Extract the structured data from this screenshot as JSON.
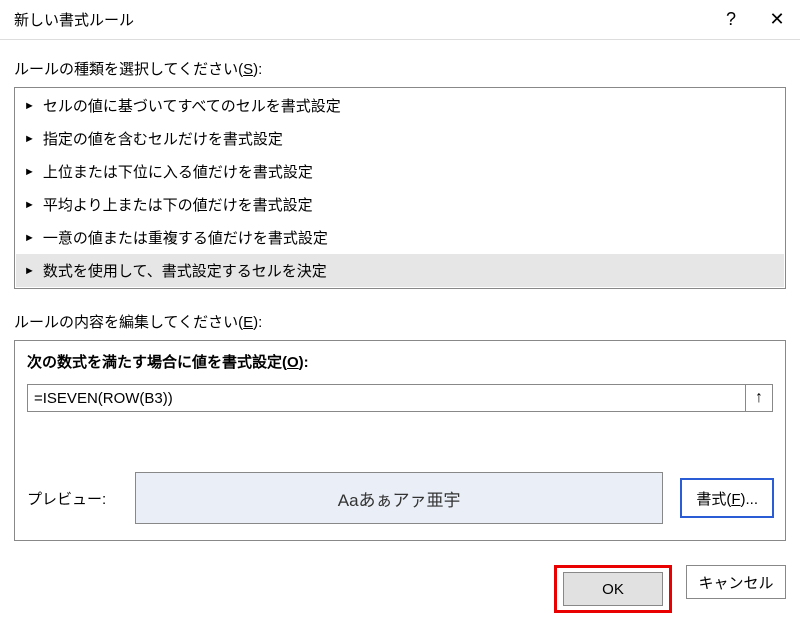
{
  "titlebar": {
    "title": "新しい書式ルール",
    "help": "?",
    "close": "✕"
  },
  "ruleTypeLabel": {
    "pre": "ルールの種類を選択してください(",
    "access": "S",
    "post": "):"
  },
  "ruleTypes": [
    "セルの値に基づいてすべてのセルを書式設定",
    "指定の値を含むセルだけを書式設定",
    "上位または下位に入る値だけを書式設定",
    "平均より上または下の値だけを書式設定",
    "一意の値または重複する値だけを書式設定",
    "数式を使用して、書式設定するセルを決定"
  ],
  "ruleSelectedIndex": 5,
  "editLabel": {
    "pre": "ルールの内容を編集してください(",
    "access": "E",
    "post": "):"
  },
  "formulaPrompt": {
    "pre": "次の数式を満たす場合に値を書式設定(",
    "access": "O",
    "post": "):"
  },
  "formulaValue": "=ISEVEN(ROW(B3))",
  "refArrow": "↑",
  "previewLabel": "プレビュー:",
  "previewText": "Aaあぁアァ亜宇",
  "formatBtn": {
    "pre": "書式(",
    "access": "F",
    "post": ")..."
  },
  "buttons": {
    "ok": "OK",
    "cancel": "キャンセル"
  },
  "arrowGlyph": "►"
}
